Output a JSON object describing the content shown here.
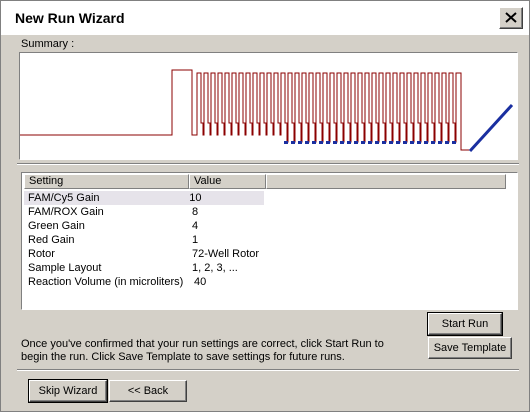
{
  "window": {
    "title": "New Run Wizard"
  },
  "summary": {
    "label": "Summary :"
  },
  "table": {
    "headers": [
      "Setting",
      "Value"
    ],
    "rows": [
      [
        "FAM/Cy5 Gain",
        "10"
      ],
      [
        "FAM/ROX Gain",
        "8"
      ],
      [
        "Green Gain",
        "4"
      ],
      [
        "Red Gain",
        "1"
      ],
      [
        "Rotor",
        "72-Well Rotor"
      ],
      [
        "Sample Layout",
        "1, 2, 3, ..."
      ],
      [
        "Reaction Volume (in microliters)",
        "40"
      ]
    ]
  },
  "info": {
    "text": "Once you've confirmed that your run settings are correct, click Start Run to begin the run. Click Save Template to save settings for future runs."
  },
  "buttons": {
    "start_run": "Start Run",
    "save_template": "Save Template",
    "skip_wizard": "Skip Wizard",
    "back": "<< Back"
  },
  "colors": {
    "profile_line": "#8b0000",
    "acquisition_marker": "#1a2fa0"
  }
}
